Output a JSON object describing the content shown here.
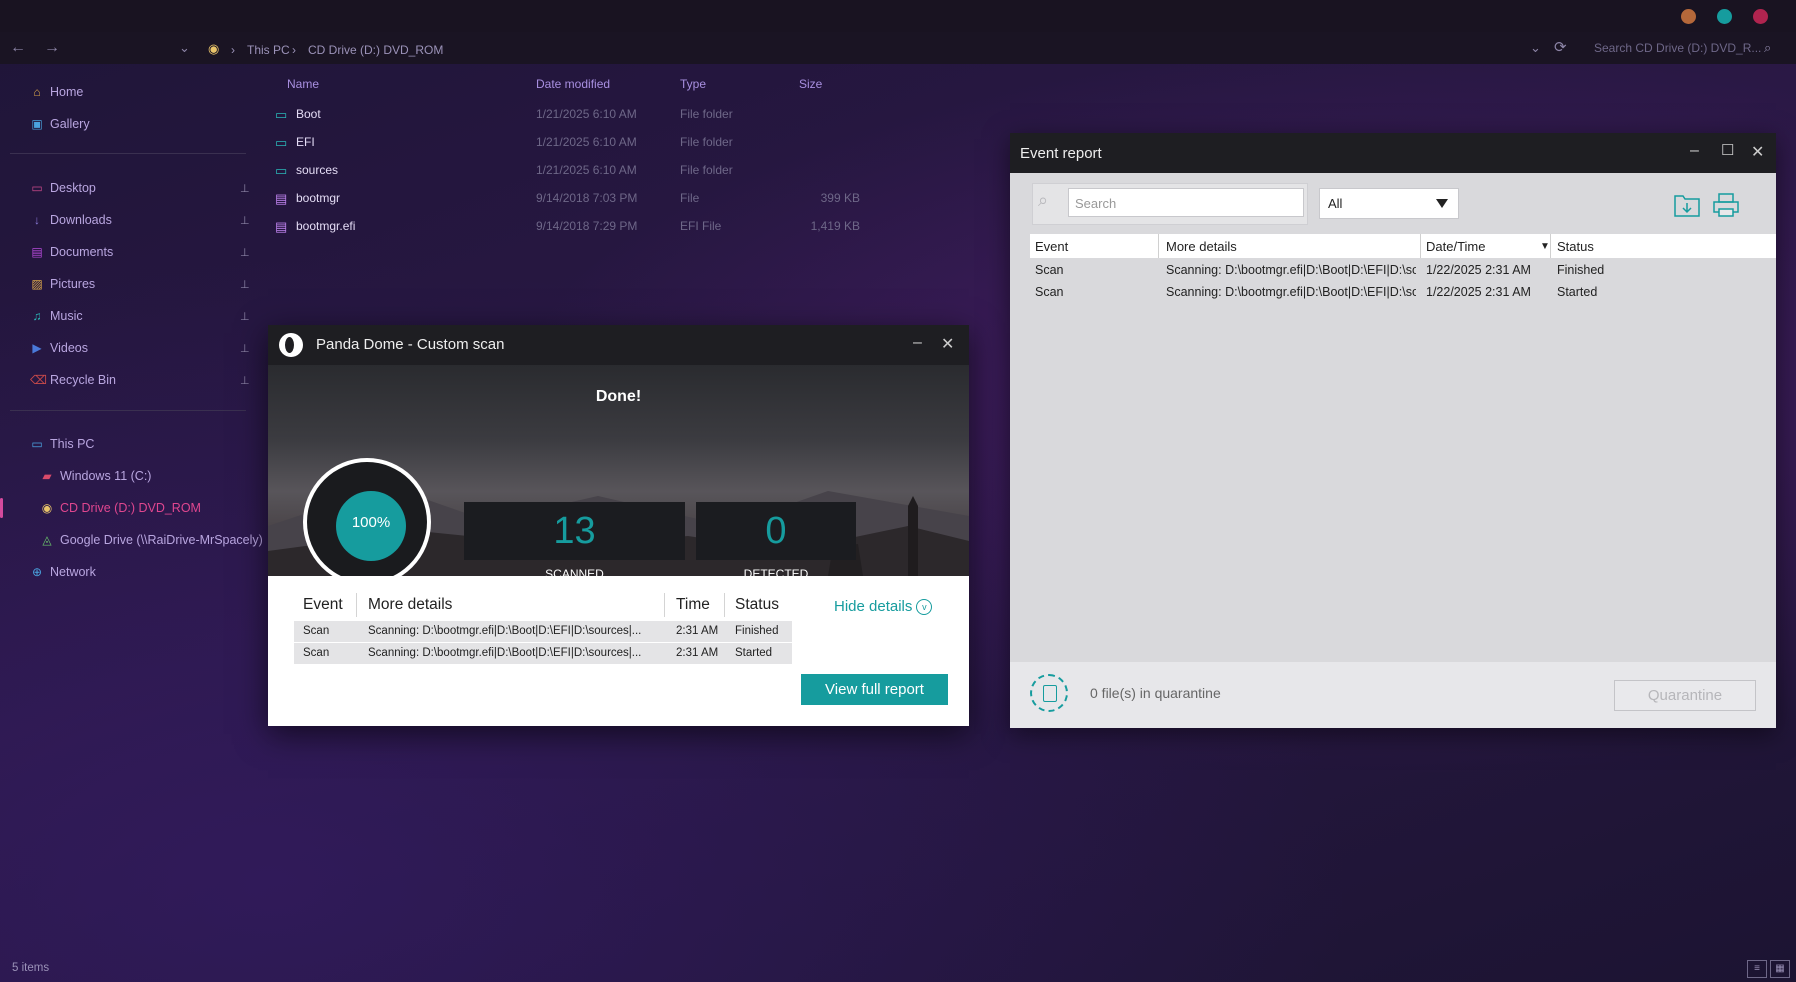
{
  "titlebar": {
    "dots": [
      "#b5683a",
      "#169c9e",
      "#b0244f"
    ]
  },
  "addressbar": {
    "back": "←",
    "forward": "→",
    "dropdown": "⌄",
    "crumbs": [
      "This PC",
      "CD Drive (D:) DVD_ROM"
    ],
    "crumb_sep": "›",
    "search_placeholder": "Search CD Drive (D:) DVD_R...",
    "refresh": "⟳"
  },
  "sidebar": {
    "quick": [
      {
        "label": "Home",
        "icon": "⌂"
      },
      {
        "label": "Gallery",
        "icon": "▣"
      }
    ],
    "pinned": [
      {
        "label": "Desktop",
        "icon": "▭"
      },
      {
        "label": "Downloads",
        "icon": "↓"
      },
      {
        "label": "Documents",
        "icon": "▤"
      },
      {
        "label": "Pictures",
        "icon": "▨"
      },
      {
        "label": "Music",
        "icon": "♫"
      },
      {
        "label": "Videos",
        "icon": "▶"
      },
      {
        "label": "Recycle Bin",
        "icon": "⌫"
      }
    ],
    "tree": [
      {
        "label": "This PC",
        "icon": "▭"
      },
      {
        "label": "Windows 11 (C:)",
        "icon": "▰"
      },
      {
        "label": "CD Drive (D:) DVD_ROM",
        "icon": "◉"
      },
      {
        "label": "Google Drive (\\\\RaiDrive-MrSpacely)",
        "icon": "◬"
      },
      {
        "label": "Network",
        "icon": "⊕"
      }
    ],
    "pin_glyph": "📌"
  },
  "files": {
    "columns": {
      "name": "Name",
      "date": "Date modified",
      "type": "Type",
      "size": "Size"
    },
    "rows": [
      {
        "name": "Boot",
        "date": "1/21/2025 6:10 AM",
        "type": "File folder",
        "size": "",
        "icon": "folder"
      },
      {
        "name": "EFI",
        "date": "1/21/2025 6:10 AM",
        "type": "File folder",
        "size": "",
        "icon": "folder"
      },
      {
        "name": "sources",
        "date": "1/21/2025 6:10 AM",
        "type": "File folder",
        "size": "",
        "icon": "folder"
      },
      {
        "name": "bootmgr",
        "date": "9/14/2018 7:03 PM",
        "type": "File",
        "size": "399 KB",
        "icon": "file"
      },
      {
        "name": "bootmgr.efi",
        "date": "9/14/2018 7:29 PM",
        "type": "EFI File",
        "size": "1,419 KB",
        "icon": "file"
      }
    ]
  },
  "statusbar": {
    "items": "5 items"
  },
  "panda": {
    "title": "Panda Dome - Custom scan",
    "done": "Done!",
    "progress_label": "100%",
    "progress": 100,
    "scanned_value": "13",
    "scanned_label": "SCANNED",
    "detected_value": "0",
    "detected_label": "DETECTED",
    "table_headers": {
      "event": "Event",
      "details": "More details",
      "time": "Time",
      "status": "Status"
    },
    "rows": [
      {
        "event": "Scan",
        "details": "Scanning: D:\\bootmgr.efi|D:\\Boot|D:\\EFI|D:\\sources|...",
        "time": "2:31 AM",
        "status": "Finished"
      },
      {
        "event": "Scan",
        "details": "Scanning: D:\\bootmgr.efi|D:\\Boot|D:\\EFI|D:\\sources|...",
        "time": "2:31 AM",
        "status": "Started"
      }
    ],
    "hide_details": "Hide details",
    "view_full_report": "View full report",
    "minimize": "–",
    "close": "✕"
  },
  "event_report": {
    "title": "Event report",
    "search_placeholder": "Search",
    "filter_value": "All",
    "headers": {
      "event": "Event",
      "details": "More details",
      "datetime": "Date/Time",
      "status": "Status"
    },
    "rows": [
      {
        "event": "Scan",
        "details": "Scanning: D:\\bootmgr.efi|D:\\Boot|D:\\EFI|D:\\sources|...",
        "datetime": "1/22/2025 2:31 AM",
        "status": "Finished"
      },
      {
        "event": "Scan",
        "details": "Scanning: D:\\bootmgr.efi|D:\\Boot|D:\\EFI|D:\\sources|...",
        "datetime": "1/22/2025 2:31 AM",
        "status": "Started"
      }
    ],
    "quarantine_text": "0 file(s) in quarantine",
    "quarantine_button": "Quarantine",
    "minimize": "–",
    "maximize": "☐",
    "close": "✕"
  },
  "colors": {
    "accent": "#169c9e",
    "active_nav": "#d44a9d"
  }
}
